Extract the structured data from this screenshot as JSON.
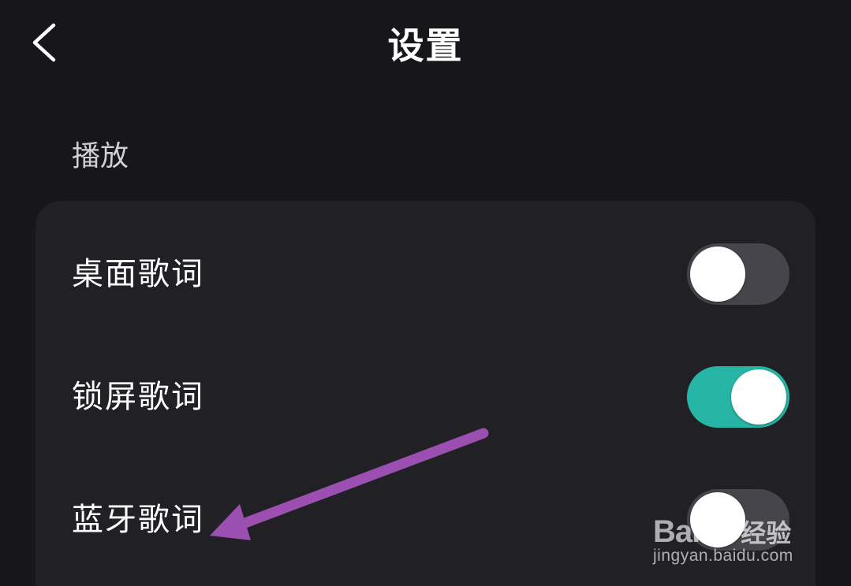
{
  "header": {
    "title": "设置"
  },
  "section": {
    "title": "播放"
  },
  "settings": [
    {
      "label": "桌面歌词",
      "enabled": false
    },
    {
      "label": "锁屏歌词",
      "enabled": true
    },
    {
      "label": "蓝牙歌词",
      "enabled": false
    }
  ],
  "watermark": {
    "brand_left": "Bai",
    "brand_right": "经验",
    "url": "jingyan.baidu.com"
  },
  "colors": {
    "background": "#17171b",
    "card": "#212125",
    "toggle_on": "#27b6a5",
    "toggle_off": "#45454b",
    "annotation_arrow": "#9b4fb0"
  },
  "icons": {
    "back": "chevron-left-icon",
    "annotation": "arrow-annotation-icon",
    "watermark_logo": "baidu-paw-icon"
  }
}
